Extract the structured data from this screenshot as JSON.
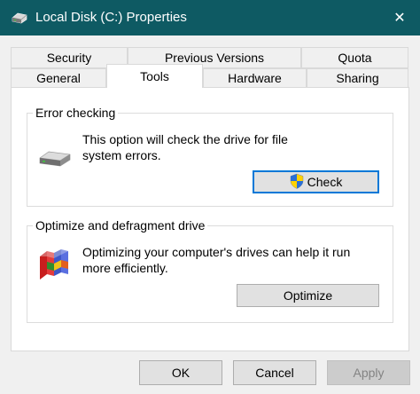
{
  "window": {
    "title": "Local Disk (C:) Properties",
    "accent": "#0e5a63",
    "close_symbol": "✕"
  },
  "tabs": {
    "row1": [
      "Security",
      "Previous Versions",
      "Quota"
    ],
    "row2": [
      "General",
      "Tools",
      "Hardware",
      "Sharing"
    ],
    "active": "Tools"
  },
  "error_checking": {
    "title": "Error checking",
    "description_line1": "This option will check the drive for file",
    "description_line2": "system errors.",
    "button_label": "Check",
    "icon": "drive-icon"
  },
  "optimize": {
    "title": "Optimize and defragment drive",
    "description_line1": "Optimizing your computer's drives can help it run",
    "description_line2": "more efficiently.",
    "button_label": "Optimize",
    "icon": "defrag-icon"
  },
  "footer": {
    "ok_label": "OK",
    "cancel_label": "Cancel",
    "apply_label": "Apply"
  }
}
